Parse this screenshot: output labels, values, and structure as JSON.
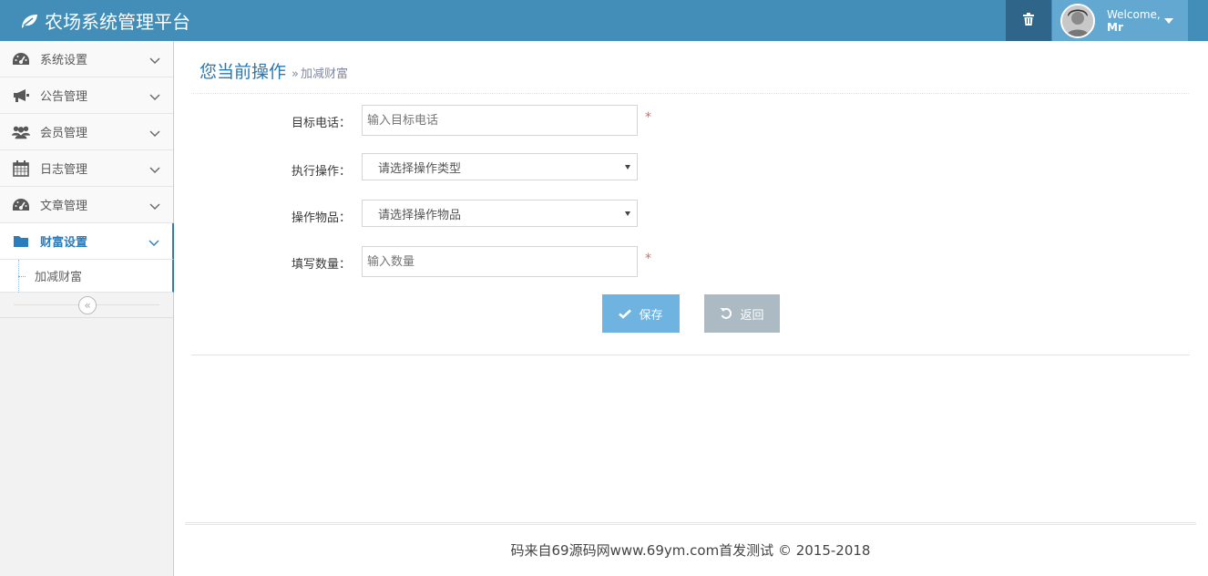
{
  "header": {
    "brand": "农场系统管理平台",
    "welcome": "Welcome,",
    "user_name": "Mr",
    "icons": {
      "brand": "leaf-icon",
      "trash": "trash-icon",
      "dropdown": "caret-down-icon"
    }
  },
  "sidebar": {
    "items": [
      {
        "label": "系统设置",
        "icon": "dashboard-icon"
      },
      {
        "label": "公告管理",
        "icon": "bullhorn-icon"
      },
      {
        "label": "会员管理",
        "icon": "users-icon"
      },
      {
        "label": "日志管理",
        "icon": "calendar-icon"
      },
      {
        "label": "文章管理",
        "icon": "dashboard-icon"
      },
      {
        "label": "财富设置",
        "icon": "folder-icon",
        "active": true
      }
    ],
    "sub_items": [
      {
        "label": "加减财富"
      }
    ]
  },
  "page_header": {
    "title": "您当前操作",
    "breadcrumb": "加减财富"
  },
  "form": {
    "phone": {
      "label": "目标电话：",
      "placeholder": "输入目标电话",
      "required": "*"
    },
    "operation": {
      "label": "执行操作：",
      "selected": "请选择操作类型"
    },
    "item": {
      "label": "操作物品：",
      "selected": "请选择操作物品"
    },
    "quantity": {
      "label": "填写数量：",
      "placeholder": "输入数量",
      "required": "*"
    },
    "save_label": "保存",
    "back_label": "返回"
  },
  "footer": {
    "text": "码来自69源码网www.69ym.com首发测试 © 2015-2018"
  },
  "colors": {
    "navbar": "#438eb9",
    "accent": "#2b7dbc",
    "save": "#6fb3e0",
    "back": "#abbac3"
  }
}
